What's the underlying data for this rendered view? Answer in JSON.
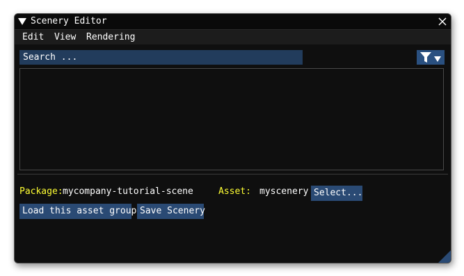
{
  "window": {
    "title": "Scenery Editor"
  },
  "menu": {
    "items": [
      "Edit",
      "View",
      "Rendering"
    ]
  },
  "search": {
    "placeholder": "Search ..."
  },
  "package": {
    "label": "Package:",
    "value": "mycompany-tutorial-scene"
  },
  "asset": {
    "label": "Asset:",
    "value": "myscenery",
    "select_label": "Select..."
  },
  "actions": {
    "load_label": "Load this asset group",
    "save_label": "Save Scenery"
  },
  "icons": {
    "collapse": "triangle-down-icon",
    "close": "close-icon",
    "filter": "filter-icon",
    "resize": "resize-grip-icon"
  },
  "colors": {
    "label_yellow": "#ffff33",
    "button_blue": "#2a4a74",
    "input_blue": "#223c5c",
    "filter_blue": "#2a5080"
  }
}
